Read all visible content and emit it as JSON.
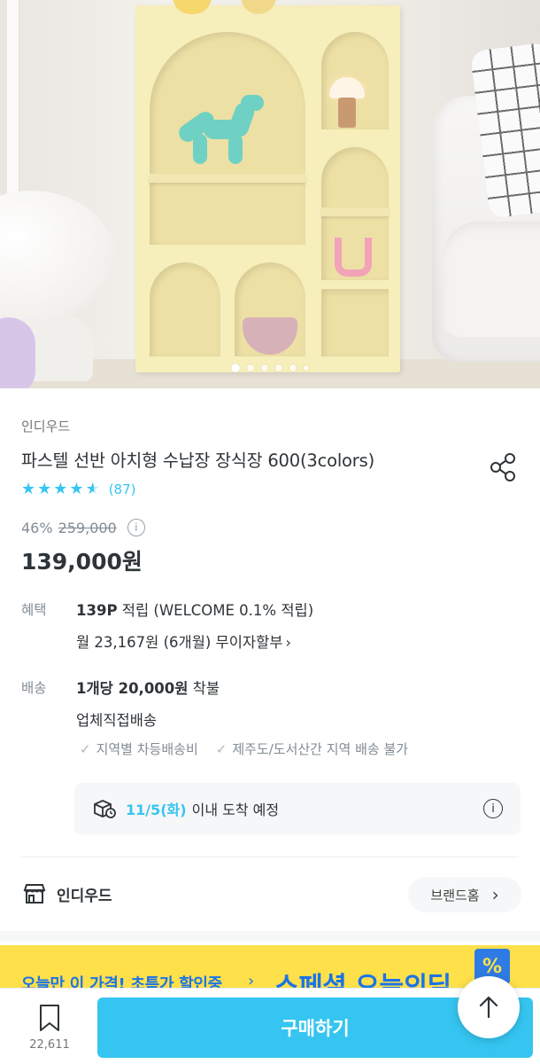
{
  "carousel": {
    "slide_count": 6,
    "active_index": 0
  },
  "product": {
    "brand": "인디우드",
    "title": "파스텔 선반 아치형 수납장 장식장 600(3colors)",
    "rating": 4.5,
    "review_count": "(87)",
    "discount": "46%",
    "original_price": "259,000",
    "price": "139,000원"
  },
  "benefit": {
    "label": "혜택",
    "points_bold": "139P",
    "points_rest": " 적립 (WELCOME 0.1% 적립)",
    "installment": "월 23,167원 (6개월) 무이자할부"
  },
  "shipping": {
    "label": "배송",
    "fee_bold": "1개당 20,000원",
    "fee_rest": " 착불",
    "method": "업체직접배송",
    "notes": [
      "지역별 차등배송비",
      "제주도/도서산간 지역 배송 불가"
    ]
  },
  "arrival": {
    "date": "11/5(화)",
    "text": "이내 도착 예정"
  },
  "store": {
    "name": "인디우드",
    "home_button": "브랜드홈"
  },
  "promo": {
    "text": "오늘만 이 가격! 초특가 할인중",
    "headline": "스페셜 오늘의딜",
    "badge": "%"
  },
  "bottom": {
    "scrap_count": "22,611",
    "buy_label": "구매하기"
  },
  "colors": {
    "accent": "#35c5f0",
    "promo_bg": "#fde04a",
    "promo_text": "#1a73e8"
  }
}
